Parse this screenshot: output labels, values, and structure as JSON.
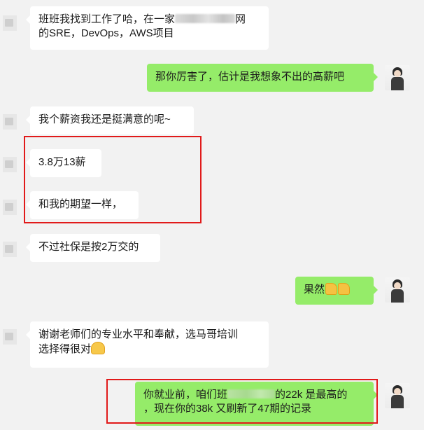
{
  "messages": [
    {
      "side": "left",
      "line1_a": "班班我找到工作了哈，在一家",
      "line1_b": "网",
      "line2": "的SRE，DevOps，AWS项目"
    },
    {
      "side": "right",
      "text": "那你厉害了，估计是我想象不出的高薪吧"
    },
    {
      "side": "left",
      "text": "我个薪资我还是挺满意的呢~"
    },
    {
      "side": "left",
      "text": "3.8万13薪"
    },
    {
      "side": "left",
      "text": "和我的期望一样，"
    },
    {
      "side": "left",
      "text": "不过社保是按2万交的"
    },
    {
      "side": "right",
      "text": "果然",
      "emoji": [
        "thumbs-up",
        "thumbs-up"
      ]
    },
    {
      "side": "left",
      "line1": "谢谢老师们的专业水平和奉献，选马哥培训",
      "line2": "选择得很对",
      "emoji": "praying-hands"
    },
    {
      "side": "right",
      "line1_a": "你就业前，咱们班",
      "line1_b": "的22k 是最高的",
      "line2": "，现在你的38k 又刷新了47期的记录"
    }
  ],
  "colors": {
    "background": "#f2f2f2",
    "left_bubble": "#ffffff",
    "right_bubble": "#95ec69",
    "highlight_box": "#e11a1a"
  }
}
